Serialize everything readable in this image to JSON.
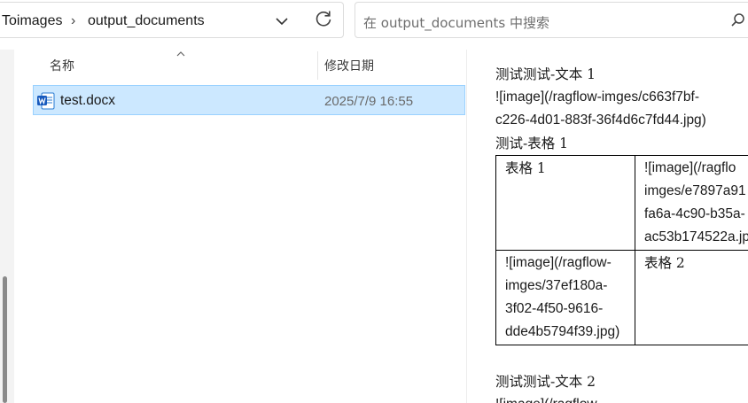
{
  "address": {
    "crumbs": [
      "Toimages",
      "output_documents"
    ],
    "separator": "›"
  },
  "search": {
    "placeholder": "在 output_documents 中搜索"
  },
  "filelist": {
    "columns": [
      "名称",
      "修改日期"
    ],
    "rows": [
      {
        "name": "test.docx",
        "modified": "2025/7/9 16:55",
        "selected": true
      }
    ]
  },
  "preview": {
    "heading1": "测试测试-文本 1",
    "image1_line1": "![image](/ragflow-imges/c663f7bf-",
    "image1_line2": "c226-4d01-883f-36f4d6c7fd44.jpg)",
    "heading2": "测试-表格 1",
    "table": {
      "r1c1": "表格 1",
      "r1c2": [
        "![image](/ragflo",
        "imges/e7897a91",
        "fa6a-4c90-b35a-",
        "ac53b174522a.jp"
      ],
      "r2c1": [
        "![image](/ragflow-",
        "imges/37ef180a-",
        "3f02-4f50-9616-",
        "dde4b5794f39.jpg)"
      ],
      "r2c2": "表格 2"
    },
    "heading3": "测试测试-文本 2",
    "image2_line1": "![image](/ragflow-"
  },
  "colors": {
    "selection_bg": "#cce8ff",
    "selection_border": "#99d1ff",
    "word_blue": "#185abd"
  },
  "icons": [
    "chevron-down-icon",
    "refresh-icon",
    "search-icon",
    "sort-up-icon",
    "word-doc-icon"
  ]
}
